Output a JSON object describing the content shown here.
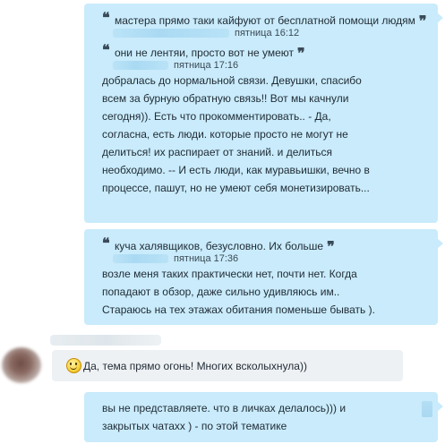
{
  "messages": {
    "m1": {
      "quote1": {
        "text": "мастера прямо таки кайфуют от бесплатной помощи людям",
        "time": "пятница 16:12"
      },
      "quote2": {
        "text": "они не лентяи, просто вот не умеют",
        "time": "пятница 17:16"
      },
      "lines": [
        "добралась до нормальной связи. Девушки, спасибо",
        "всем за бурную обратную связь!! Вот мы качнули",
        "сегодня)).  Есть что прокомментировать.. - Да,",
        "согласна, есть люди. которые просто не могут не",
        "делиться! их распирает от знаний. и делиться",
        "необходимо. -- И есть люди, как муравьишки, вечно в",
        "процессе, пашут, но не умеют себя монетизировать..."
      ]
    },
    "m2": {
      "quote": {
        "text": "куча халявщиков, безусловно. Их больше",
        "time": "пятница 17:36"
      },
      "lines": [
        "возле меня таких практически нет, почти нет. Когда",
        "попадают в обзор, даже сильно удивляюсь им..",
        "Стараюсь на тех этажах обитания поменьше бывать )."
      ]
    },
    "incoming": {
      "text": "Да, тема прямо огонь! Многих всколыхнула))"
    },
    "m3": {
      "lines": [
        "вы не представляете. что в личках делалось))) и",
        "закрытых чатахх ) - по этой тематике"
      ]
    }
  },
  "quote_open": "❝",
  "quote_close": "❞",
  "icons": {
    "quote": "quote-icon",
    "smiley": "smiley-icon",
    "avatar": "avatar"
  },
  "colors": {
    "outgoing_bubble": "#c9ebfb",
    "incoming_bubble": "#eef1f4",
    "text": "#1f2a35"
  }
}
